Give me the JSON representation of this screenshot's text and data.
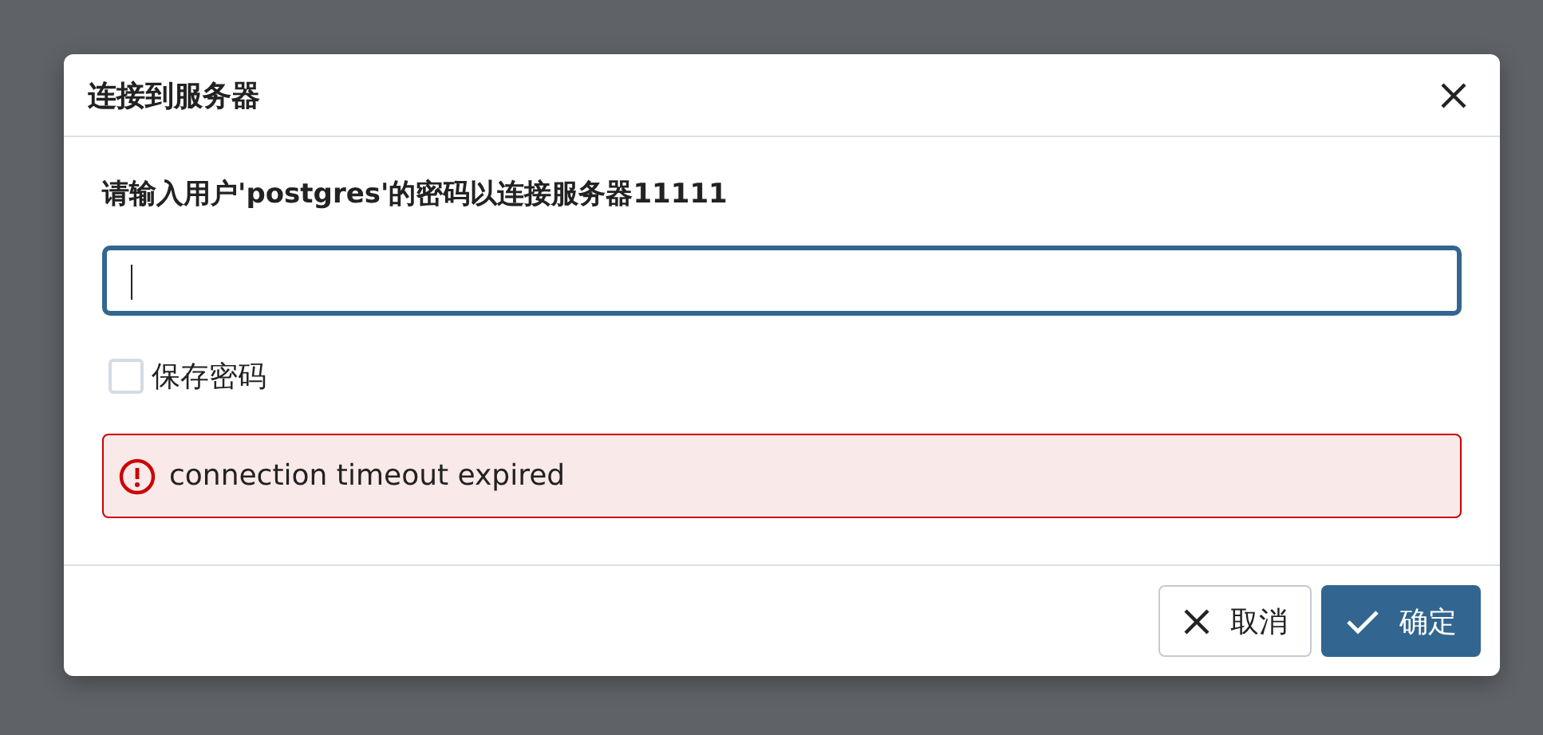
{
  "dialog": {
    "title": "连接到服务器"
  },
  "prompt": "请输入用户'postgres'的密码以连接服务器11111",
  "password_field": {
    "focused": true
  },
  "save_password": {
    "label": "保存密码",
    "checked": false
  },
  "error": {
    "message": "connection timeout expired"
  },
  "buttons": [
    {
      "label": "取消",
      "kind": "cancel",
      "primary": false
    },
    {
      "label": "确定",
      "kind": "ok",
      "primary": true
    }
  ]
}
